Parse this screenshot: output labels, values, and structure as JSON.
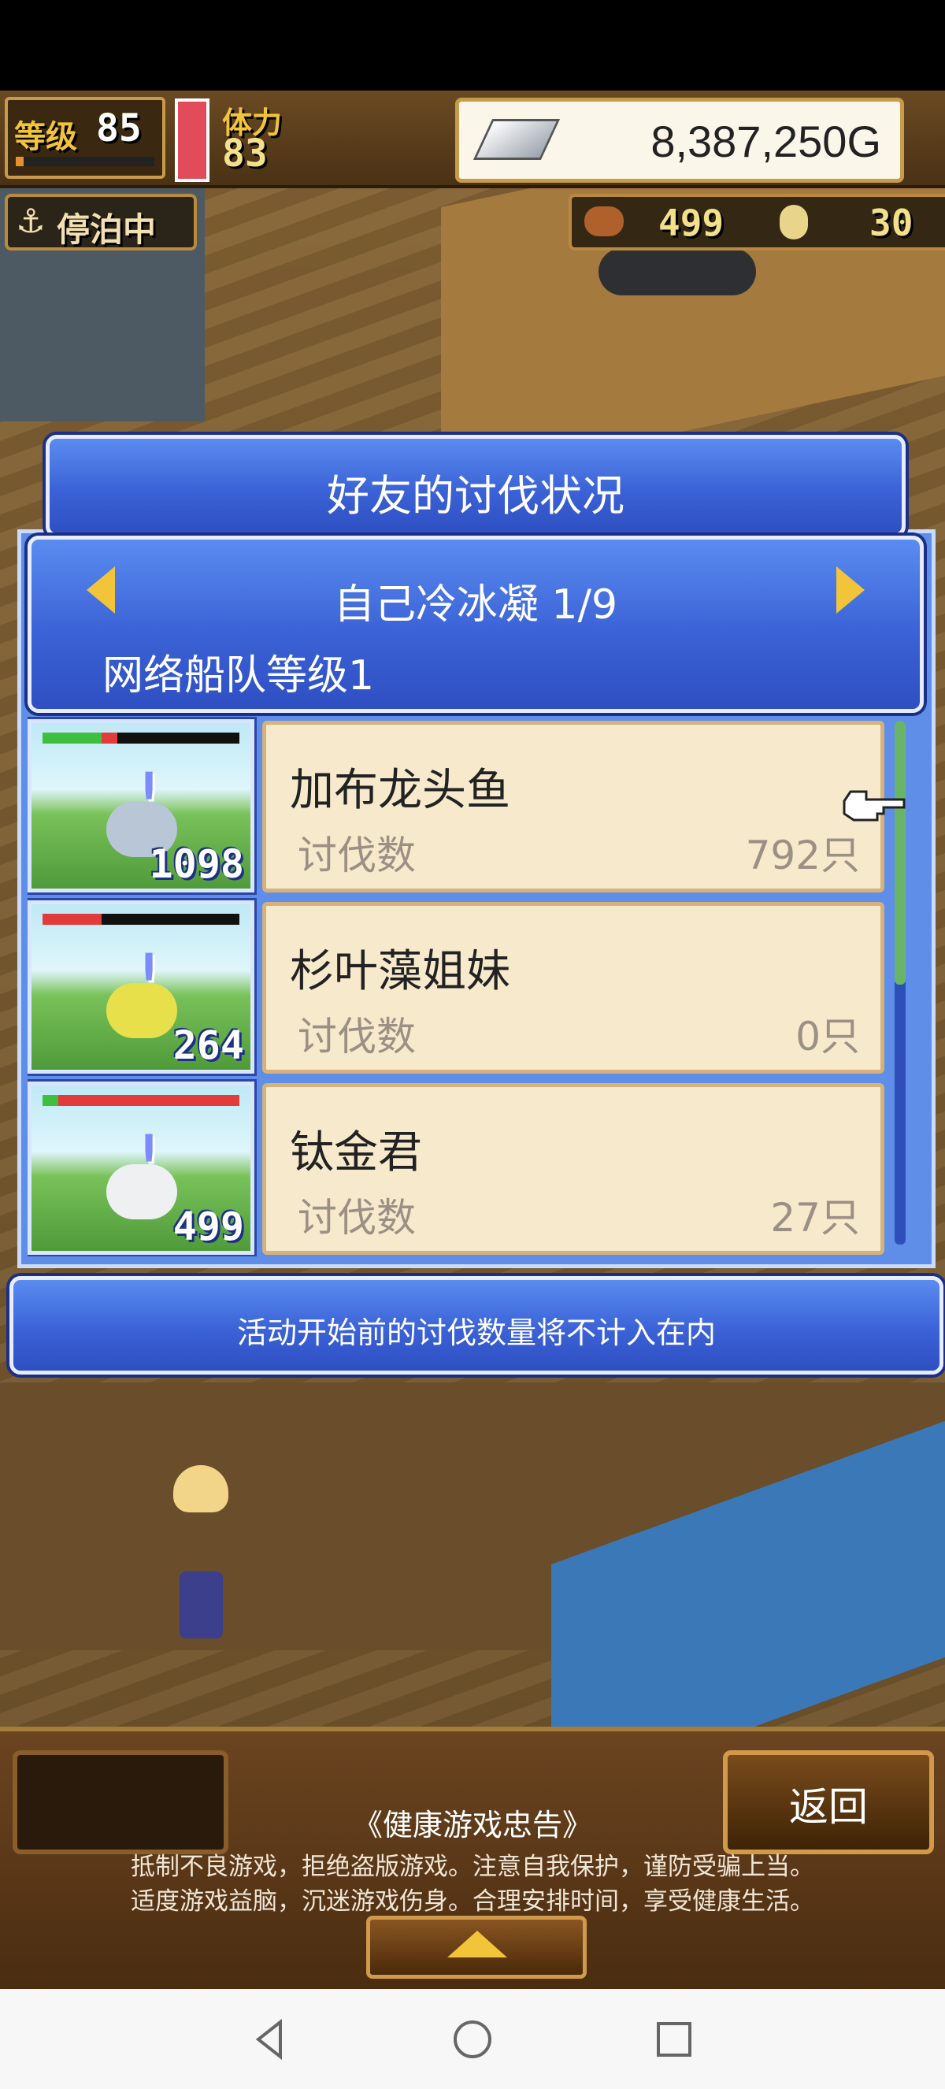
{
  "hud": {
    "level_label": "等级",
    "level_value": "85",
    "stamina_label": "体力",
    "stamina_value": "83",
    "gold": "8,387,250G",
    "status_label": "停泊中",
    "resource1": "499",
    "resource2": "30"
  },
  "dialog": {
    "title": "好友的讨伐状况",
    "friend_name": "自己冷冰凝 1/9",
    "fleet_level": "网络船队等级1",
    "items": [
      {
        "name": "加布龙头鱼",
        "kill_label": "讨伐数",
        "kill_value": "792只",
        "thumb_count": "1098",
        "hp_fraction": 0.3,
        "hp_color": "#3fbf3f"
      },
      {
        "name": "杉叶藻姐妹",
        "kill_label": "讨伐数",
        "kill_value": "0只",
        "thumb_count": "264",
        "hp_fraction": 0.3,
        "hp_color": "#e23b3b"
      },
      {
        "name": "钛金君",
        "kill_label": "讨伐数",
        "kill_value": "27只",
        "thumb_count": "499",
        "hp_fraction": 1.0,
        "hp_color": "#e23b3b"
      }
    ],
    "notice": "活动开始前的讨伐数量将不计入在内"
  },
  "bottom": {
    "back_label": "返回",
    "health_title": "《健康游戏忠告》",
    "health_line1": "抵制不良游戏，拒绝盗版游戏。注意自我保护，谨防受骗上当。",
    "health_line2": "适度游戏益脑，沉迷游戏伤身。合理安排时间，享受健康生活。"
  },
  "colors": {
    "dialog_blue": "#3b62d6",
    "card_bg": "#f6e9cc",
    "accent_gold": "#f2c43a"
  }
}
